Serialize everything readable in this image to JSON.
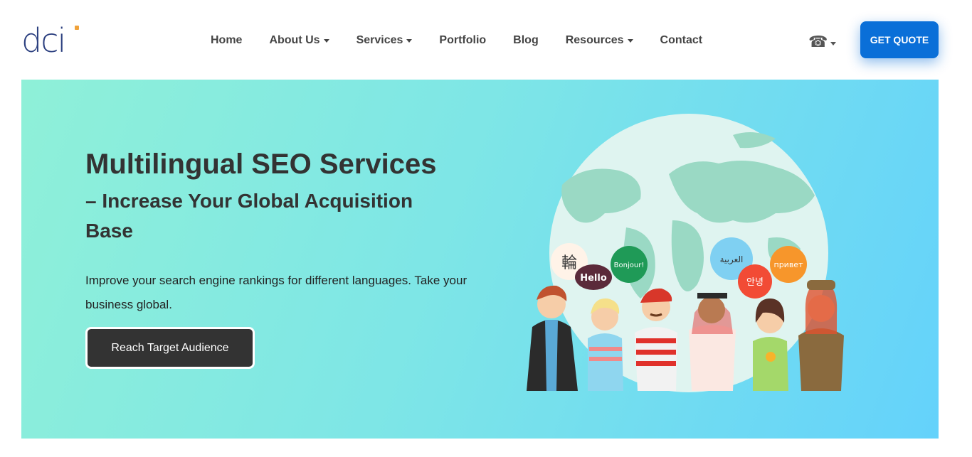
{
  "header": {
    "logo_text": "dci",
    "nav": [
      {
        "label": "Home",
        "dropdown": false
      },
      {
        "label": "About Us",
        "dropdown": true
      },
      {
        "label": "Services",
        "dropdown": true
      },
      {
        "label": "Portfolio",
        "dropdown": false
      },
      {
        "label": "Blog",
        "dropdown": false
      },
      {
        "label": "Resources",
        "dropdown": true
      },
      {
        "label": "Contact",
        "dropdown": false
      }
    ],
    "phone_icon": "☎",
    "quote_label": "GET QUOTE"
  },
  "hero": {
    "title": "Multilingual SEO Services",
    "subtitle": "– Increase Your Global Acquisition Base",
    "description": "Improve your search engine rankings for different languages. Take your business global.",
    "cta_label": "Reach Target Audience",
    "bubbles": [
      "輪",
      "Hello",
      "Bonjour!",
      "العربية",
      "안녕",
      "привет"
    ]
  },
  "colors": {
    "accent": "#0a6fd8",
    "logo": "#2b3f7f",
    "logo_dot": "#f0a23a",
    "cta_bg": "#333333"
  }
}
